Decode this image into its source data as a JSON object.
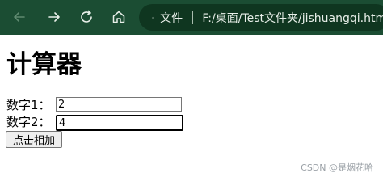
{
  "browser": {
    "site_info_label": "文件",
    "url": "F:/桌面/Test文件夹/jishuangqi.html",
    "icons": [
      "back-arrow-icon",
      "forward-arrow-icon",
      "refresh-icon",
      "home-icon",
      "info-icon"
    ],
    "colors": {
      "toolbar": "#1b4d33",
      "address_bar": "#0f3620"
    }
  },
  "page": {
    "title": "计算器",
    "fields": [
      {
        "label": "数字1：",
        "value": "2"
      },
      {
        "label": "数字2：",
        "value": "4"
      }
    ],
    "button_label": "点击相加"
  },
  "watermark": "CSDN @是烟花哈"
}
